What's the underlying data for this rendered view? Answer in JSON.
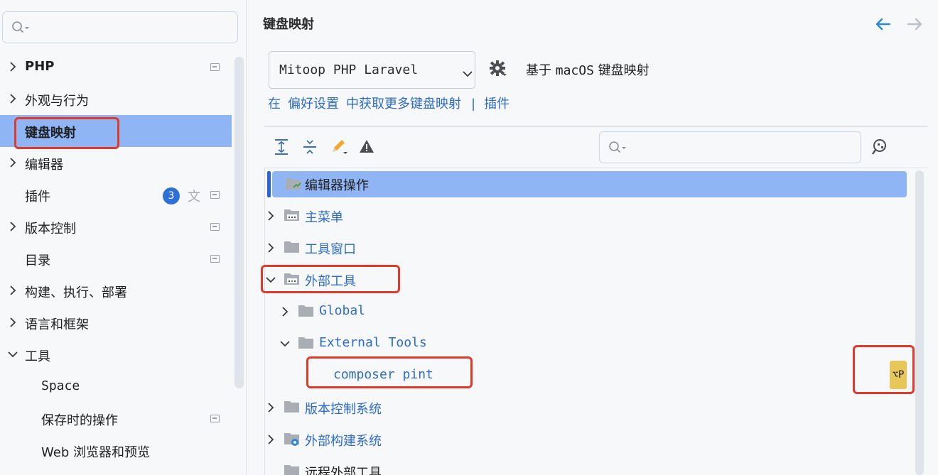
{
  "sidebar": {
    "search_placeholder": "",
    "items": [
      {
        "label": "PHP",
        "expandable": true,
        "expanded": false,
        "bold": true,
        "has_mini": true
      },
      {
        "label": "外观与行为",
        "expandable": true,
        "expanded": false,
        "has_mini": false
      },
      {
        "label": "键盘映射",
        "expandable": false,
        "selected": true,
        "has_mini": false
      },
      {
        "label": "编辑器",
        "expandable": true,
        "expanded": false,
        "has_mini": false
      },
      {
        "label": "插件",
        "expandable": false,
        "badge": "3",
        "has_translate": true,
        "has_mini": true
      },
      {
        "label": "版本控制",
        "expandable": true,
        "expanded": false,
        "has_mini": true
      },
      {
        "label": "目录",
        "expandable": false,
        "has_mini": true
      },
      {
        "label": "构建、执行、部署",
        "expandable": true,
        "expanded": false,
        "has_mini": false
      },
      {
        "label": "语言和框架",
        "expandable": true,
        "expanded": false,
        "has_mini": false
      },
      {
        "label": "工具",
        "expandable": true,
        "expanded": true,
        "has_mini": false
      },
      {
        "label": "Space",
        "sub": true,
        "has_mini": false
      },
      {
        "label": "保存时的操作",
        "sub": true,
        "has_mini": true
      },
      {
        "label": "Web 浏览器和预览",
        "sub": true,
        "has_mini": false
      }
    ]
  },
  "main": {
    "title": "键盘映射",
    "keymap_select_value": "Mitoop PHP Laravel",
    "based_on_prefix": "基于",
    "based_on_os": "macOS",
    "based_on_suffix": "键盘映射",
    "links": {
      "pre": "在",
      "prefs": "偏好设置",
      "more": "中获取更多键盘映射",
      "sep": "|",
      "plugins": "插件"
    },
    "find_placeholder": "",
    "actions": [
      {
        "label": "编辑器操作",
        "level": 0,
        "expanded": false,
        "selected": true,
        "folder": "editor"
      },
      {
        "label": "主菜单",
        "level": 0,
        "expanded": false,
        "folder": "menu"
      },
      {
        "label": "工具窗口",
        "level": 0,
        "expanded": false,
        "folder": "plain"
      },
      {
        "label": "外部工具",
        "level": 0,
        "expanded": true,
        "folder": "menu"
      },
      {
        "label": "Global",
        "level": 1,
        "expanded": false,
        "folder": "plain",
        "mono": true
      },
      {
        "label": "External Tools",
        "level": 1,
        "expanded": true,
        "folder": "plain",
        "mono": true
      },
      {
        "label": "composer pint",
        "level": 2,
        "leaf": true,
        "mono": true,
        "shortcut": "⌥P"
      },
      {
        "label": "版本控制系统",
        "level": 0,
        "expanded": false,
        "folder": "plain"
      },
      {
        "label": "外部构建系统",
        "level": 0,
        "expanded": false,
        "folder": "gear"
      },
      {
        "label": "远程外部工具",
        "level": 0,
        "expanded": false,
        "folder": "plain"
      }
    ]
  },
  "colors": {
    "selection": "#8fb5f5",
    "link": "#2e6bce",
    "highlight_box": "#e03b2a",
    "badge": "#2f6fd8",
    "shortcut_chip": "#e8c75a"
  }
}
